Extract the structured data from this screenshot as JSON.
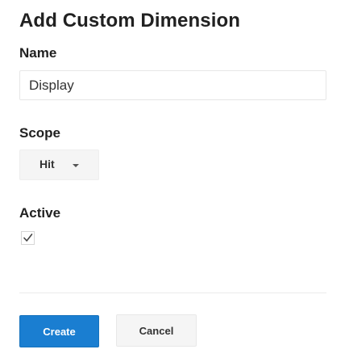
{
  "dialog": {
    "title": "Add Custom Dimension"
  },
  "fields": {
    "name": {
      "label": "Name",
      "value": "Display"
    },
    "scope": {
      "label": "Scope",
      "selected": "Hit"
    },
    "active": {
      "label": "Active",
      "checked": true
    }
  },
  "actions": {
    "create_label": "Create",
    "cancel_label": "Cancel"
  },
  "icons": {
    "dropdown": "chevron-down-icon",
    "checkmark": "checkmark-icon"
  },
  "colors": {
    "primary_button": "#1a7ed1",
    "text": "#212121"
  }
}
